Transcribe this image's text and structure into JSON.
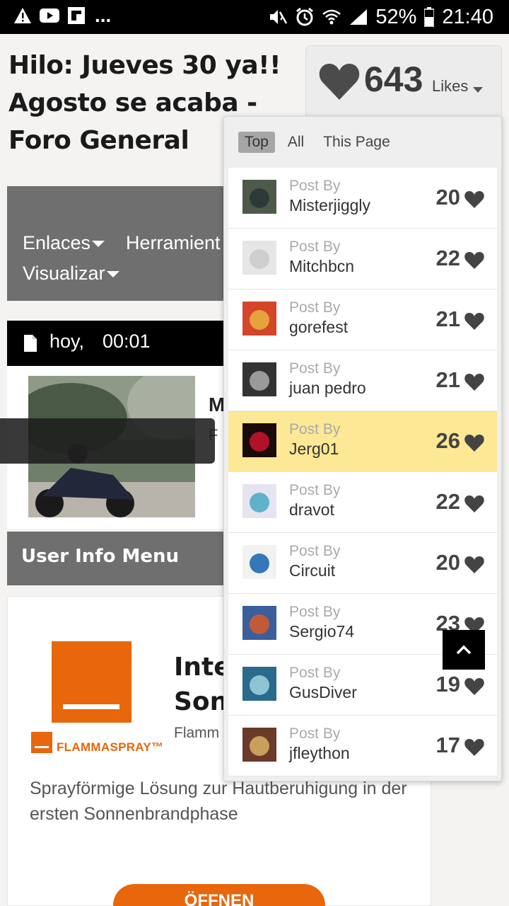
{
  "status_bar": {
    "battery": "52%",
    "time": "21:40",
    "overflow": "...",
    "left_icons": [
      "warning-icon",
      "youtube-icon",
      "flipboard-icon"
    ],
    "right_icons": [
      "mute-icon",
      "alarm-icon",
      "wifi-icon",
      "signal-icon",
      "battery-icon"
    ]
  },
  "page": {
    "title": "Hilo: Jueves 30 ya!! Agosto se acaba - Foro General"
  },
  "likes": {
    "count": "643",
    "label": "Likes"
  },
  "nav": {
    "items": [
      "Enlaces",
      "Herramient",
      "Visualizar"
    ]
  },
  "post": {
    "date": "hoy,",
    "time": "00:01",
    "author_initial": "M",
    "author_sub": "F"
  },
  "user_info": {
    "label": "User Info Menu"
  },
  "ad": {
    "headline_line1": "Inte",
    "headline_line2": "Son",
    "brand": "FLAMMASPRAY™",
    "sub": "Flamm",
    "description": "Sprayförmige Lösung zur Hautberuhigung in der ersten Sonnenbrandphase",
    "button": "ÖFFNEN"
  },
  "dropdown": {
    "tabs": [
      "Top",
      "All",
      "This Page"
    ],
    "active_tab": "Top",
    "post_by_label": "Post By",
    "rows": [
      {
        "user": "Misterjiggly",
        "count": "20",
        "highlighted": false,
        "avatar_colors": [
          "#4d5a4a",
          "#2c3a3a"
        ]
      },
      {
        "user": "Mitchbcn",
        "count": "22",
        "highlighted": false,
        "avatar_colors": [
          "#e6e6e6",
          "#cfcfcf"
        ]
      },
      {
        "user": "gorefest",
        "count": "21",
        "highlighted": false,
        "avatar_colors": [
          "#d4462a",
          "#e6a23c"
        ]
      },
      {
        "user": "juan pedro",
        "count": "21",
        "highlighted": false,
        "avatar_colors": [
          "#333333",
          "#9a9a9a"
        ]
      },
      {
        "user": "Jerg01",
        "count": "26",
        "highlighted": true,
        "avatar_colors": [
          "#1a0a0a",
          "#b1122a"
        ]
      },
      {
        "user": "dravot",
        "count": "22",
        "highlighted": false,
        "avatar_colors": [
          "#e7e4f2",
          "#5fb3c8"
        ]
      },
      {
        "user": "Circuit",
        "count": "20",
        "highlighted": false,
        "avatar_colors": [
          "#f2f2f2",
          "#3478b8"
        ]
      },
      {
        "user": "Sergio74",
        "count": "23",
        "highlighted": false,
        "avatar_colors": [
          "#3a5f9a",
          "#c25a3a"
        ]
      },
      {
        "user": "GusDiver",
        "count": "19",
        "highlighted": false,
        "avatar_colors": [
          "#2a6a8a",
          "#8fc4d4"
        ]
      },
      {
        "user": "jfleython",
        "count": "17",
        "highlighted": false,
        "avatar_colors": [
          "#6a3a2a",
          "#c8a05a"
        ]
      }
    ]
  },
  "colors": {
    "accent_orange": "#e8660c",
    "highlight_yellow": "#fce895",
    "nav_grey": "#6f6f6f"
  }
}
